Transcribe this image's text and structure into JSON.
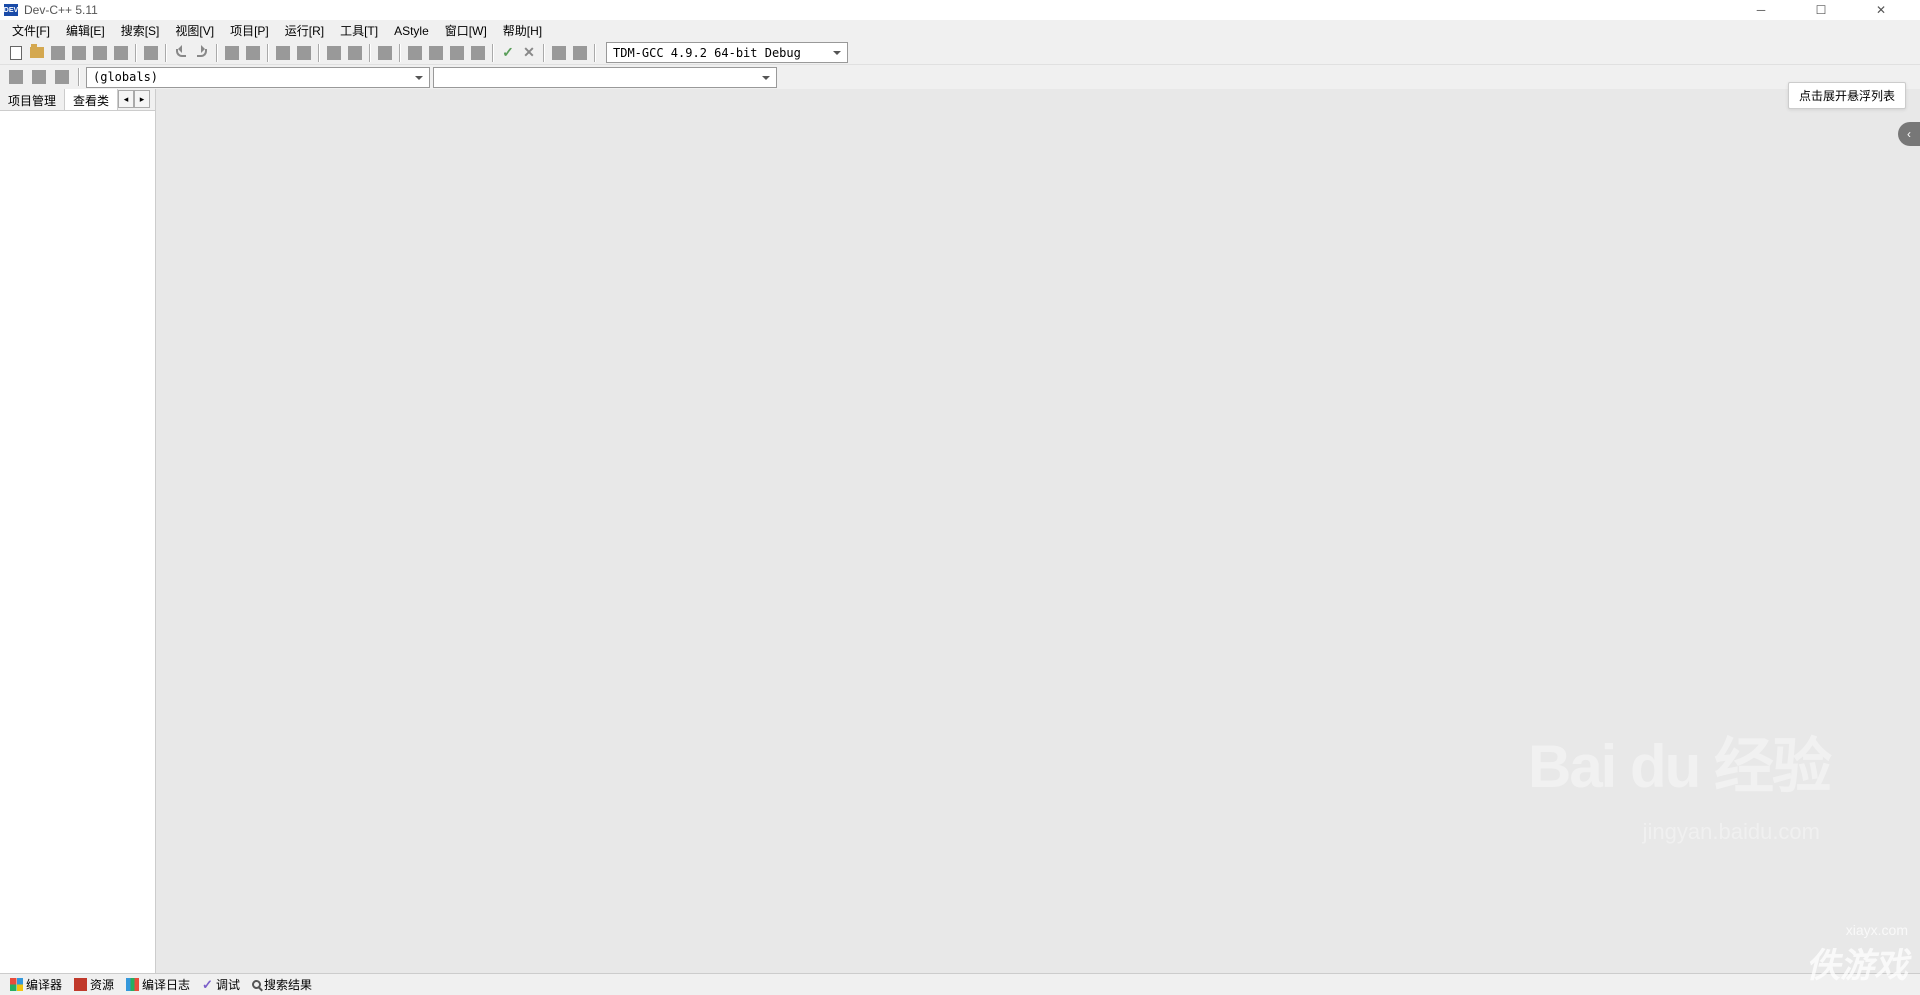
{
  "title": "Dev-C++ 5.11",
  "menu": {
    "file": "文件[F]",
    "edit": "编辑[E]",
    "search": "搜索[S]",
    "view": "视图[V]",
    "project": "项目[P]",
    "run": "运行[R]",
    "tools": "工具[T]",
    "astyle": "AStyle",
    "window": "窗口[W]",
    "help": "帮助[H]"
  },
  "compiler_selector": "TDM-GCC 4.9.2 64-bit Debug",
  "scope_selector": "(globals)",
  "side_tabs": {
    "project": "项目管理",
    "classes": "查看类"
  },
  "status": {
    "compiler": "编译器",
    "resources": "资源",
    "log": "编译日志",
    "debug": "调试",
    "results": "搜索结果"
  },
  "tooltip_text": "点击展开悬浮列表",
  "watermark": {
    "brand": "Bai du 经验",
    "url": "jingyan.baidu.com",
    "game_site": "xiayx.com",
    "game_text": "佚游戏"
  }
}
